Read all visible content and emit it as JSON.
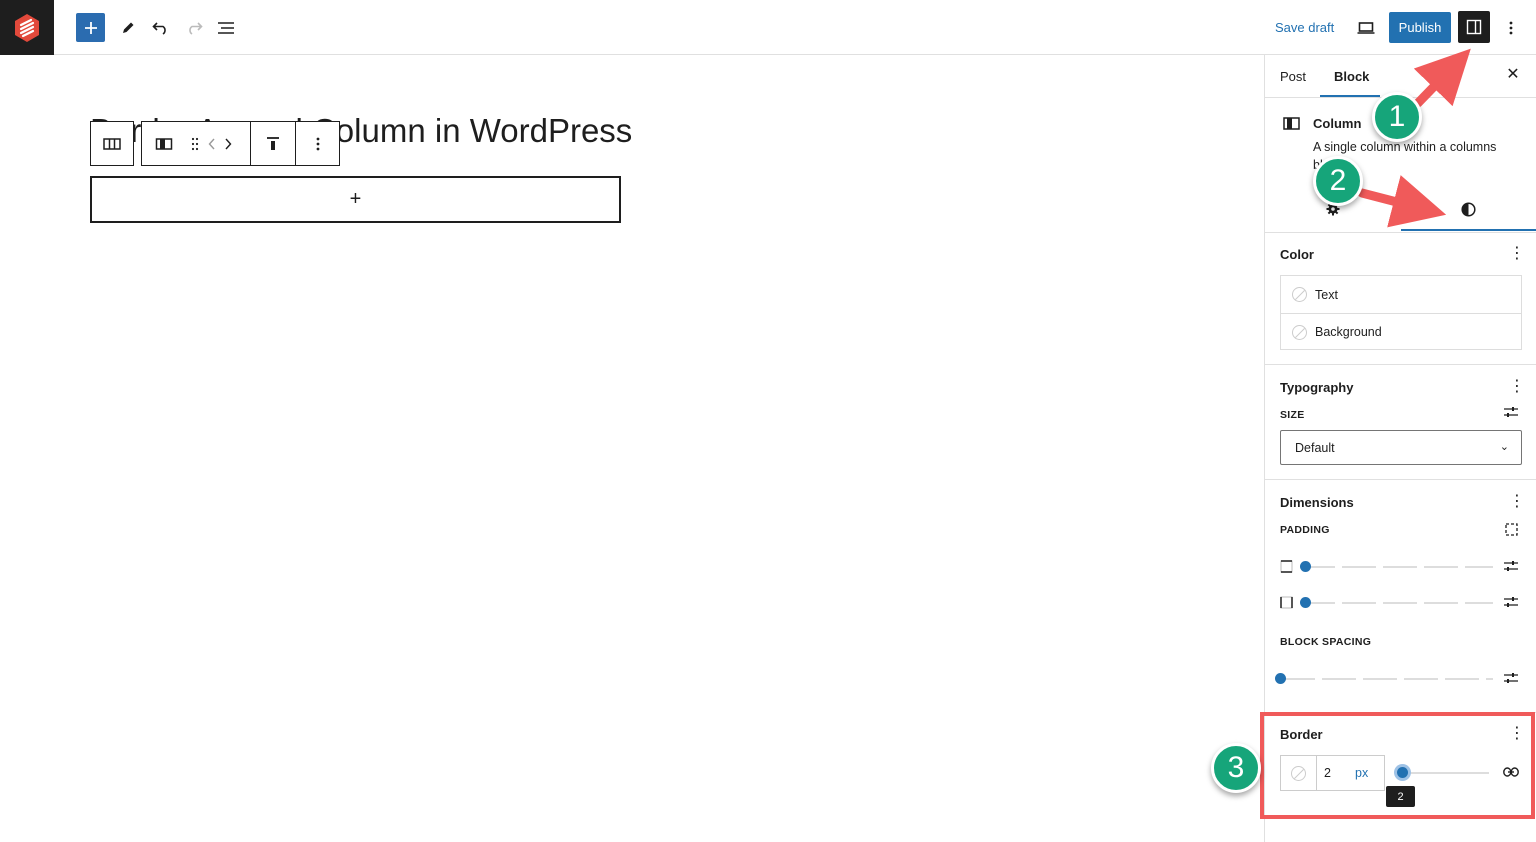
{
  "toolbar": {
    "add_label": "+",
    "save_draft": "Save draft",
    "publish": "Publish"
  },
  "editor": {
    "post_title": "Border Around Column in WordPress",
    "column_appender": "+"
  },
  "sidebar": {
    "tabs": [
      "Post",
      "Block"
    ],
    "active_tab": "Block",
    "close": "✕",
    "block_card": {
      "title": "Column",
      "description": "A single column within a columns block."
    },
    "color": {
      "title": "Color",
      "items": [
        "Text",
        "Background"
      ]
    },
    "typography": {
      "title": "Typography",
      "size_label": "SIZE",
      "size_value": "Default"
    },
    "dimensions": {
      "title": "Dimensions",
      "padding_label": "PADDING",
      "block_spacing_label": "BLOCK SPACING"
    },
    "border": {
      "title": "Border",
      "width_value": "2",
      "unit": "px",
      "slider_value": 2,
      "tooltip": "2"
    }
  },
  "annotations": {
    "badges": [
      "1",
      "2",
      "3"
    ],
    "accent_color": "#f05a5a",
    "badge_color": "#16a57a"
  },
  "colors": {
    "primary": "#2271b1",
    "dark": "#1e1e1e"
  }
}
